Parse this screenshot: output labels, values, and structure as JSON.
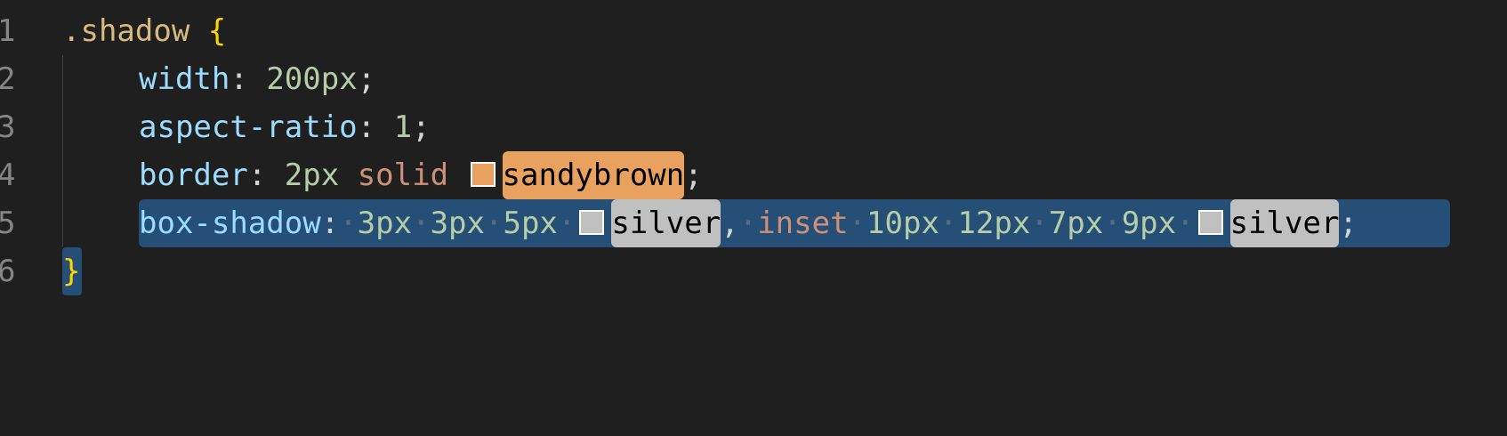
{
  "editor": {
    "line_numbers": [
      "1",
      "2",
      "3",
      "4",
      "5",
      "6"
    ],
    "line1": {
      "selector": ".shadow",
      "brace": "{"
    },
    "line2": {
      "prop": "width",
      "colon": ":",
      "value": "200px",
      "semi": ";"
    },
    "line3": {
      "prop": "aspect-ratio",
      "colon": ":",
      "value": "1",
      "semi": ";"
    },
    "line4": {
      "prop": "border",
      "colon": ":",
      "v1": "2px",
      "v2": "solid",
      "color_name": "sandybrown",
      "semi": ";"
    },
    "line5": {
      "prop": "box-shadow",
      "colon": ":",
      "v1": "3px",
      "v2": "3px",
      "v3": "5px",
      "color1": "silver",
      "comma": ",",
      "kw": "inset",
      "v4": "10px",
      "v5": "12px",
      "v6": "7px",
      "v7": "9px",
      "color2": "silver",
      "semi": ";"
    },
    "line6": {
      "brace": "}"
    },
    "whitespace_dot": "·"
  },
  "colors": {
    "background": "#1f1f1f",
    "selection": "#264f78",
    "sandybrown": "#e8a15e",
    "silver": "#c0c0c0"
  }
}
